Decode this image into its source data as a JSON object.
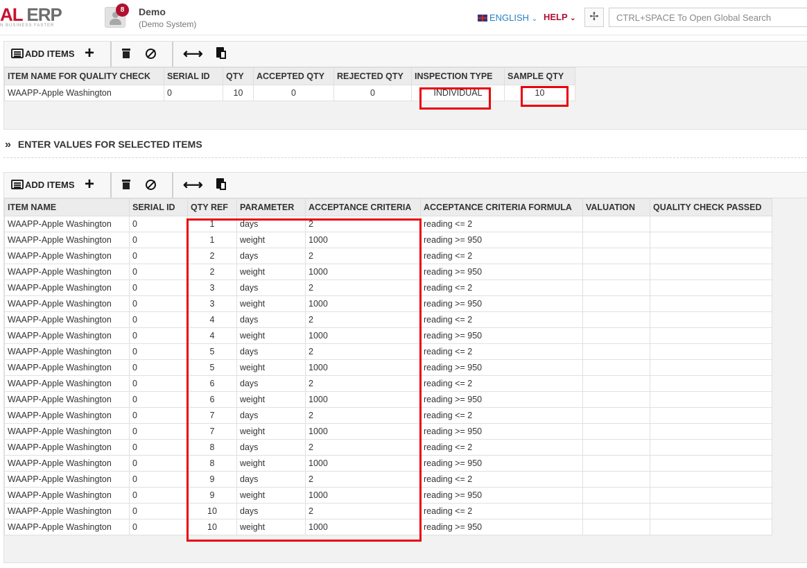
{
  "header": {
    "logo_accent": "AL",
    "logo_text": " ERP",
    "logo_tagline": "N BUSINESS FASTER",
    "notifications_count": "8",
    "user_name": "Demo",
    "user_system": "(Demo System)",
    "language": "ENGLISH",
    "help": "HELP",
    "search_placeholder": "CTRL+SPACE To Open Global Search"
  },
  "toolbar": {
    "add_items": "ADD ITEMS"
  },
  "top_table": {
    "columns": [
      "ITEM NAME FOR QUALITY CHECK",
      "SERIAL ID",
      "QTY",
      "ACCEPTED QTY",
      "REJECTED QTY",
      "INSPECTION TYPE",
      "SAMPLE QTY"
    ],
    "row": {
      "item": "WAAPP-Apple Washington",
      "serial": "0",
      "qty": "10",
      "accepted": "0",
      "rejected": "0",
      "inspection": "INDIVIDUAL",
      "sample": "10"
    }
  },
  "section": {
    "title": "ENTER VALUES FOR SELECTED ITEMS"
  },
  "bottom_table": {
    "columns": [
      "ITEM NAME",
      "SERIAL ID",
      "QTY REF",
      "PARAMETER",
      "ACCEPTANCE CRITERIA",
      "ACCEPTANCE CRITERIA FORMULA",
      "VALUATION",
      "QUALITY CHECK PASSED"
    ],
    "rows": [
      {
        "item": "WAAPP-Apple Washington",
        "serial": "0",
        "qty_ref": "1",
        "parameter": "days",
        "criteria": "2",
        "formula": "reading <= 2"
      },
      {
        "item": "WAAPP-Apple Washington",
        "serial": "0",
        "qty_ref": "1",
        "parameter": "weight",
        "criteria": "1000",
        "formula": "reading >= 950"
      },
      {
        "item": "WAAPP-Apple Washington",
        "serial": "0",
        "qty_ref": "2",
        "parameter": "days",
        "criteria": "2",
        "formula": "reading <= 2"
      },
      {
        "item": "WAAPP-Apple Washington",
        "serial": "0",
        "qty_ref": "2",
        "parameter": "weight",
        "criteria": "1000",
        "formula": "reading >= 950"
      },
      {
        "item": "WAAPP-Apple Washington",
        "serial": "0",
        "qty_ref": "3",
        "parameter": "days",
        "criteria": "2",
        "formula": "reading <= 2"
      },
      {
        "item": "WAAPP-Apple Washington",
        "serial": "0",
        "qty_ref": "3",
        "parameter": "weight",
        "criteria": "1000",
        "formula": "reading >= 950"
      },
      {
        "item": "WAAPP-Apple Washington",
        "serial": "0",
        "qty_ref": "4",
        "parameter": "days",
        "criteria": "2",
        "formula": "reading <= 2"
      },
      {
        "item": "WAAPP-Apple Washington",
        "serial": "0",
        "qty_ref": "4",
        "parameter": "weight",
        "criteria": "1000",
        "formula": "reading >= 950"
      },
      {
        "item": "WAAPP-Apple Washington",
        "serial": "0",
        "qty_ref": "5",
        "parameter": "days",
        "criteria": "2",
        "formula": "reading <= 2"
      },
      {
        "item": "WAAPP-Apple Washington",
        "serial": "0",
        "qty_ref": "5",
        "parameter": "weight",
        "criteria": "1000",
        "formula": "reading >= 950"
      },
      {
        "item": "WAAPP-Apple Washington",
        "serial": "0",
        "qty_ref": "6",
        "parameter": "days",
        "criteria": "2",
        "formula": "reading <= 2"
      },
      {
        "item": "WAAPP-Apple Washington",
        "serial": "0",
        "qty_ref": "6",
        "parameter": "weight",
        "criteria": "1000",
        "formula": "reading >= 950"
      },
      {
        "item": "WAAPP-Apple Washington",
        "serial": "0",
        "qty_ref": "7",
        "parameter": "days",
        "criteria": "2",
        "formula": "reading <= 2"
      },
      {
        "item": "WAAPP-Apple Washington",
        "serial": "0",
        "qty_ref": "7",
        "parameter": "weight",
        "criteria": "1000",
        "formula": "reading >= 950"
      },
      {
        "item": "WAAPP-Apple Washington",
        "serial": "0",
        "qty_ref": "8",
        "parameter": "days",
        "criteria": "2",
        "formula": "reading <= 2"
      },
      {
        "item": "WAAPP-Apple Washington",
        "serial": "0",
        "qty_ref": "8",
        "parameter": "weight",
        "criteria": "1000",
        "formula": "reading >= 950"
      },
      {
        "item": "WAAPP-Apple Washington",
        "serial": "0",
        "qty_ref": "9",
        "parameter": "days",
        "criteria": "2",
        "formula": "reading <= 2"
      },
      {
        "item": "WAAPP-Apple Washington",
        "serial": "0",
        "qty_ref": "9",
        "parameter": "weight",
        "criteria": "1000",
        "formula": "reading >= 950"
      },
      {
        "item": "WAAPP-Apple Washington",
        "serial": "0",
        "qty_ref": "10",
        "parameter": "days",
        "criteria": "2",
        "formula": "reading <= 2"
      },
      {
        "item": "WAAPP-Apple Washington",
        "serial": "0",
        "qty_ref": "10",
        "parameter": "weight",
        "criteria": "1000",
        "formula": "reading >= 950"
      }
    ]
  }
}
